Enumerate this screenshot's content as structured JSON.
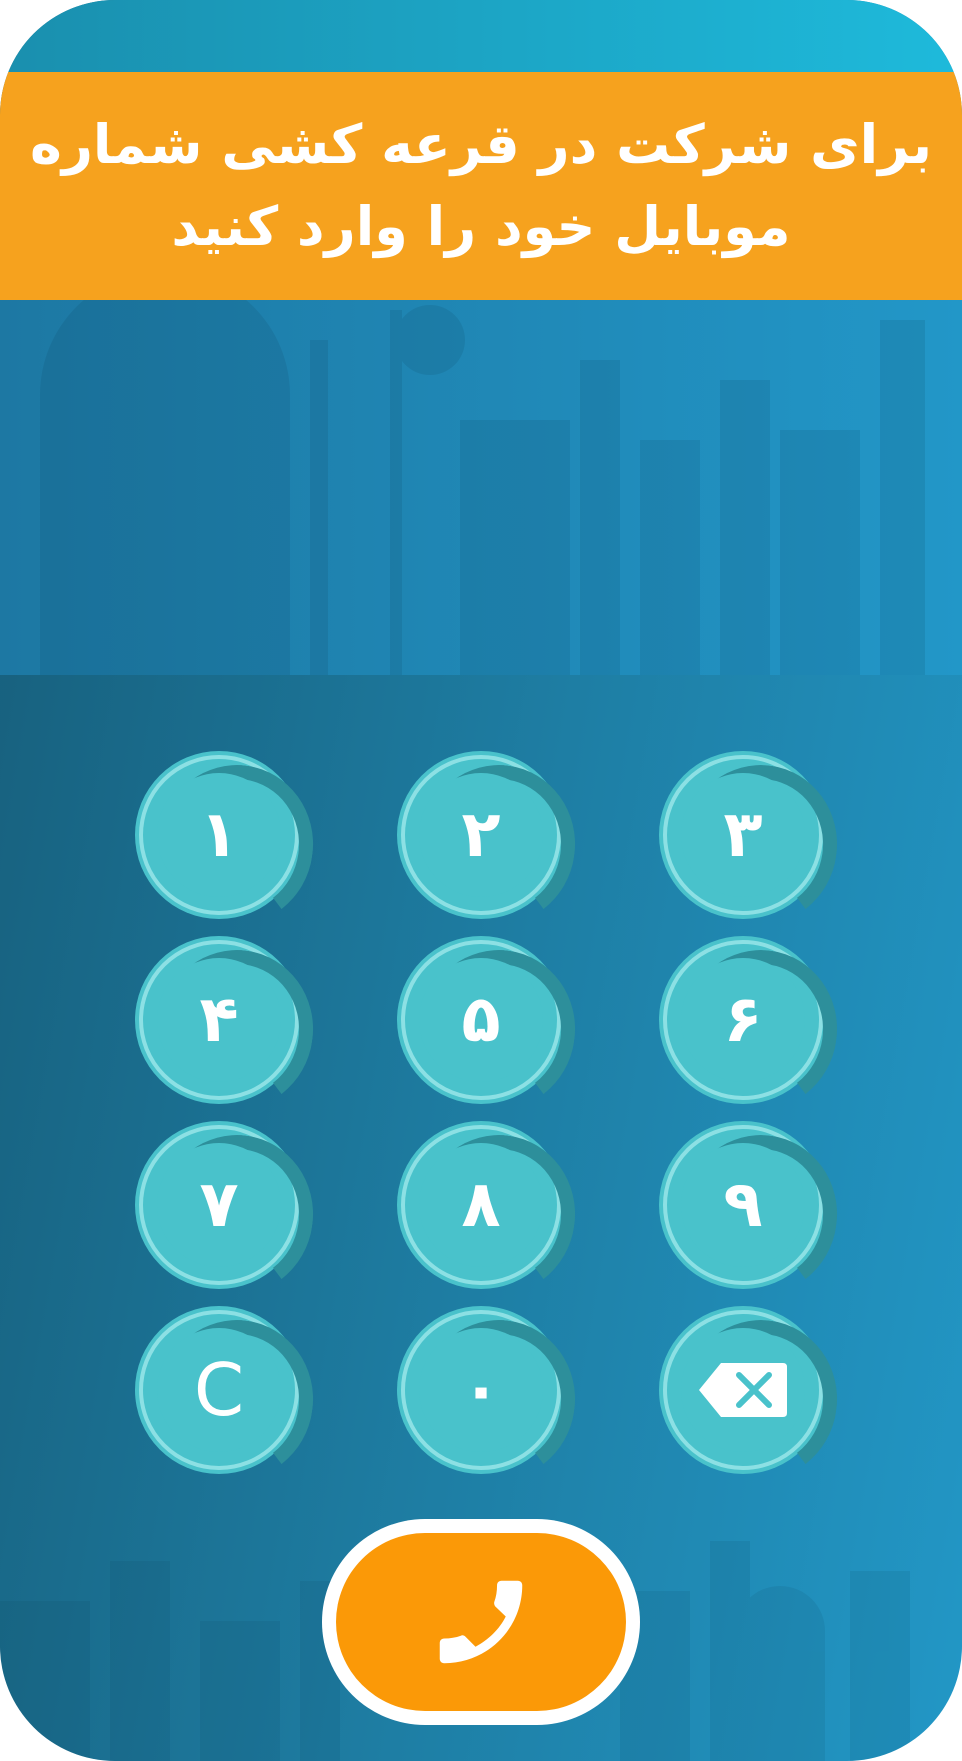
{
  "banner": {
    "line1": "برای شرکت در قرعه کشی شماره",
    "line2": "موبایل خود را وارد کنید"
  },
  "keypad": {
    "keys": [
      "۱",
      "۲",
      "۳",
      "۴",
      "۵",
      "۶",
      "۷",
      "۸",
      "۹",
      "C",
      "۰"
    ],
    "backspace_icon": "backspace-icon"
  },
  "call": {
    "icon": "phone-icon"
  },
  "colors": {
    "banner": "#f6a21e",
    "key": "#49c2cb",
    "call": "#fb9907",
    "background": "#1e7ea4"
  }
}
